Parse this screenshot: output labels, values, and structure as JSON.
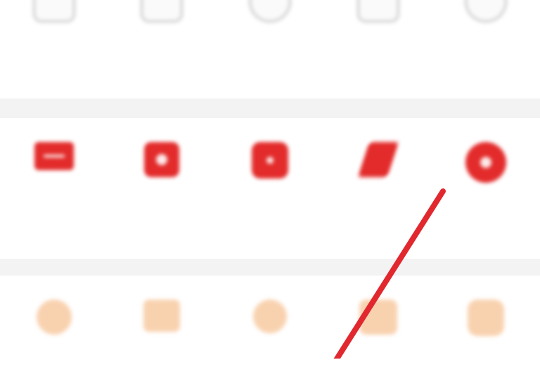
{
  "rows": [
    {
      "items": [
        {
          "label": "",
          "icon": "outline-box-icon"
        },
        {
          "label": "",
          "icon": "outline-box-icon"
        },
        {
          "label": "",
          "icon": "outline-circle-icon"
        },
        {
          "label": "",
          "icon": "outline-box-icon"
        },
        {
          "label": "",
          "icon": "outline-circle-icon"
        }
      ]
    },
    {
      "items": [
        {
          "label": "",
          "icon": "mail-icon"
        },
        {
          "label": "",
          "icon": "bag-icon"
        },
        {
          "label": "",
          "icon": "shop-icon"
        },
        {
          "label": "",
          "icon": "tag-icon"
        },
        {
          "label": "",
          "icon": "play-circle-icon"
        }
      ]
    },
    {
      "items": [
        {
          "label": "",
          "icon": "search-icon"
        },
        {
          "label": "",
          "icon": "people-icon"
        },
        {
          "label": "",
          "icon": "search-icon"
        },
        {
          "label": "",
          "icon": "card-icon"
        },
        {
          "label": "",
          "icon": "shop-icon"
        }
      ]
    }
  ],
  "colors": {
    "row2_icon": "#e32b2b",
    "row3_icon": "#f7c79c",
    "annotation_line": "#e0282e",
    "divider": "#f3f3f3"
  }
}
